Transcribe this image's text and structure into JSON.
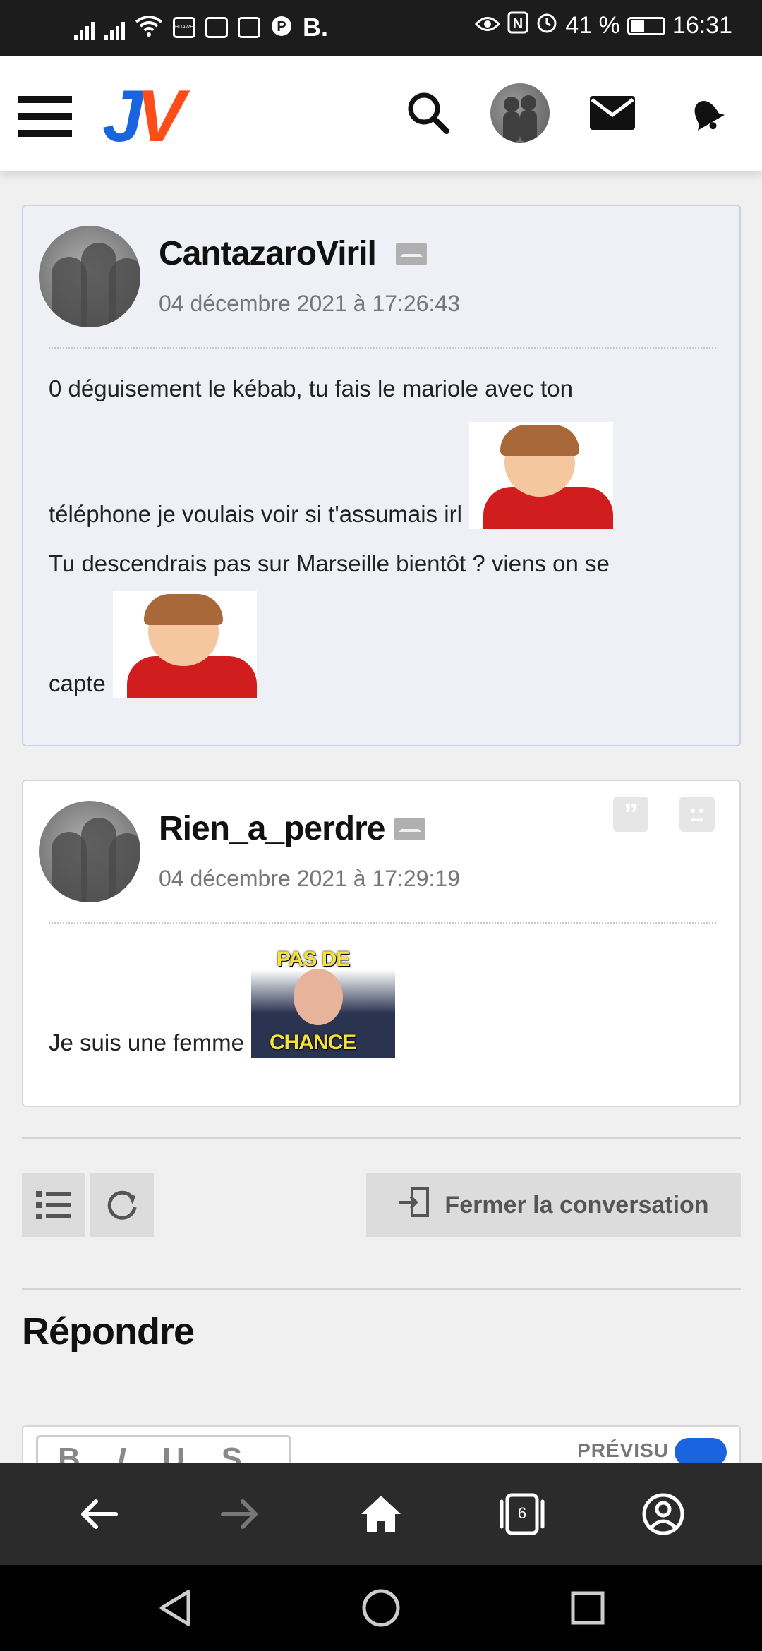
{
  "status_bar": {
    "carrier_badge": "HUAWEI",
    "left_letter": "B.",
    "battery_percent": "41 %",
    "time": "16:31"
  },
  "header": {
    "logo_j": "J",
    "logo_v": "V"
  },
  "posts": [
    {
      "username": "CantazaroViril",
      "date": "04 décembre 2021 à 17:26:43",
      "lines": [
        "0 déguisement le kébab, tu fais le mariole avec ton",
        "téléphone je voulais voir si t'assumais irl",
        "Tu descendrais pas sur Marseille bientôt ? viens on se",
        "capte"
      ]
    },
    {
      "username": "Rien_a_perdre",
      "date": "04 décembre 2021 à 17:29:19",
      "lines": [
        "Je suis une femme"
      ],
      "sticker_text_top": "PAS DE",
      "sticker_text_bottom": "CHANCE"
    }
  ],
  "toolbar": {
    "close_label": "Fermer la conversation"
  },
  "reply": {
    "title": "Répondre",
    "format_buttons": [
      "B",
      "I",
      "U",
      "S"
    ],
    "preview_label": "PRÉVISU"
  },
  "browser_nav": {
    "tab_count": "6"
  }
}
